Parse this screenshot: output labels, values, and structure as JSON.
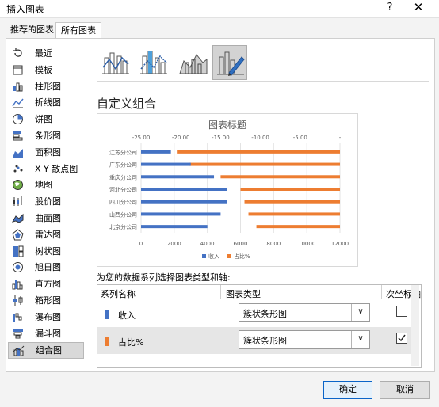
{
  "window": {
    "title": "插入图表",
    "help": "?",
    "close": "✕"
  },
  "tabs": [
    {
      "label": "推荐的图表"
    },
    {
      "label": "所有图表"
    }
  ],
  "sidebar": {
    "items": [
      {
        "label": "最近",
        "icon": "recent-icon"
      },
      {
        "label": "模板",
        "icon": "template-icon"
      },
      {
        "label": "柱形图",
        "icon": "column-chart-icon"
      },
      {
        "label": "折线图",
        "icon": "line-chart-icon"
      },
      {
        "label": "饼图",
        "icon": "pie-chart-icon"
      },
      {
        "label": "条形图",
        "icon": "bar-chart-icon"
      },
      {
        "label": "面积图",
        "icon": "area-chart-icon"
      },
      {
        "label": "X Y 散点图",
        "icon": "scatter-chart-icon"
      },
      {
        "label": "地图",
        "icon": "map-chart-icon"
      },
      {
        "label": "股价图",
        "icon": "stock-chart-icon"
      },
      {
        "label": "曲面图",
        "icon": "surface-chart-icon"
      },
      {
        "label": "雷达图",
        "icon": "radar-chart-icon"
      },
      {
        "label": "树状图",
        "icon": "treemap-chart-icon"
      },
      {
        "label": "旭日图",
        "icon": "sunburst-chart-icon"
      },
      {
        "label": "直方图",
        "icon": "histogram-chart-icon"
      },
      {
        "label": "箱形图",
        "icon": "box-whisker-chart-icon"
      },
      {
        "label": "瀑布图",
        "icon": "waterfall-chart-icon"
      },
      {
        "label": "漏斗图",
        "icon": "funnel-chart-icon"
      },
      {
        "label": "组合图",
        "icon": "combo-chart-icon",
        "selected": true
      }
    ]
  },
  "subtype_title": "自定义组合",
  "assign_label": "为您的数据系列选择图表类型和轴:",
  "table": {
    "headers": {
      "name": "系列名称",
      "type": "图表类型",
      "secondary": "次坐标轴"
    },
    "rows": [
      {
        "name": "收入",
        "type": "簇状条形图",
        "secondary": false,
        "color": "#4472c4"
      },
      {
        "name": "占比%",
        "type": "簇状条形图",
        "secondary": true,
        "color": "#ed7d31"
      }
    ]
  },
  "buttons": {
    "ok": "确定",
    "cancel": "取消"
  },
  "chart_data": {
    "type": "bar",
    "title": "图表标题",
    "categories": [
      "江苏分公司",
      "广东分公司",
      "重庆分公司",
      "河北分公司",
      "四川分公司",
      "山西分公司",
      "北京分公司"
    ],
    "series": [
      {
        "name": "收入",
        "axis": "bottom",
        "color": "#4472c4",
        "values": [
          1800,
          3000,
          4400,
          5200,
          5200,
          4800,
          4000
        ]
      },
      {
        "name": "占比%",
        "axis": "top",
        "color": "#ed7d31",
        "values": [
          -20.5,
          -19.0,
          -15.0,
          -12.5,
          -12.0,
          -11.5,
          -10.5
        ]
      }
    ],
    "x_bottom": {
      "ticks": [
        "0",
        "2000",
        "4000",
        "6000",
        "8000",
        "10000",
        "12000"
      ],
      "range": [
        0,
        12000
      ]
    },
    "x_top": {
      "ticks": [
        "-25.00",
        "-20.00",
        "-15.00",
        "-10.00",
        "-5.00",
        "-"
      ],
      "range": [
        -25,
        0
      ]
    },
    "legend_position": "bottom",
    "grid": true
  }
}
